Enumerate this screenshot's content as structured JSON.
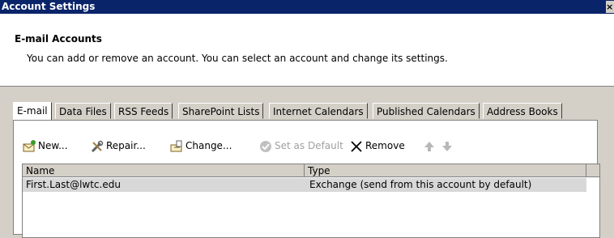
{
  "window": {
    "title": "Account Settings",
    "close_glyph": "×"
  },
  "header": {
    "title": "E-mail Accounts",
    "description": "You can add or remove an account. You can select an account and change its settings."
  },
  "tabs": [
    {
      "label": "E-mail",
      "active": true
    },
    {
      "label": "Data Files"
    },
    {
      "label": "RSS Feeds"
    },
    {
      "label": "SharePoint Lists"
    },
    {
      "label": "Internet Calendars"
    },
    {
      "label": "Published Calendars"
    },
    {
      "label": "Address Books"
    }
  ],
  "toolbar": {
    "new_label": "New...",
    "repair_label": "Repair...",
    "change_label": "Change...",
    "default_label": "Set as Default",
    "remove_label": "Remove"
  },
  "accounts": {
    "columns": [
      "Name",
      "Type"
    ],
    "rows": [
      {
        "name": "First.Last@lwtc.edu",
        "type": "Exchange (send from this account by default)"
      }
    ]
  },
  "colors": {
    "title_bar": "#0a246a",
    "dialog_bg": "#d4d0c8",
    "selected_row": "#d8d8d8"
  }
}
